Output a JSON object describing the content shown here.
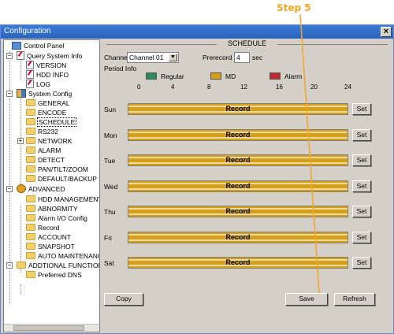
{
  "annotation": {
    "step_label": "Step 5"
  },
  "window": {
    "title": "Configuration",
    "close_glyph": "×"
  },
  "tree": {
    "root": "Control Panel",
    "query": {
      "label": "Query System Info",
      "children": [
        "VERSION",
        "HDD INFO",
        "LOG"
      ]
    },
    "system": {
      "label": "System Config",
      "children": [
        "GENERAL",
        "ENCODE",
        "SCHEDULE",
        "RS232",
        "NETWORK",
        "ALARM",
        "DETECT",
        "PAN/TILT/ZOOM",
        "DEFAULT/BACKUP"
      ]
    },
    "advanced": {
      "label": "ADVANCED",
      "children": [
        "HDD MANAGEMENT",
        "ABNORMITY",
        "Alarm I/O Config",
        "Record",
        "ACCOUNT",
        "SNAPSHOT",
        "AUTO MAINTENANCE"
      ]
    },
    "additional": {
      "label": "ADDTIONAL FUNCTION",
      "children": [
        "Preferred DNS"
      ]
    },
    "expander_minus": "−",
    "expander_plus": "+"
  },
  "schedule": {
    "section_title": "SCHEDULE",
    "channel_label": "Channel",
    "channel_value": "Channel 01",
    "prerecord_label": "Prerecord",
    "prerecord_value": "4",
    "prerecord_unit": "sec",
    "period_info_label": "Period Info",
    "legend": [
      {
        "label": "Regular",
        "color": "#2e8b57"
      },
      {
        "label": "MD",
        "color": "#d4a017"
      },
      {
        "label": "Alarm",
        "color": "#c0282d"
      }
    ],
    "hour_ticks": [
      "0",
      "4",
      "8",
      "12",
      "16",
      "20",
      "24"
    ],
    "days": [
      "Sun",
      "Mon",
      "Tue",
      "Wed",
      "Thu",
      "Fri",
      "Sat"
    ],
    "bar_text": "Record",
    "set_label": "Set",
    "copy_label": "Copy",
    "save_label": "Save",
    "refresh_label": "Refresh",
    "dropdown_glyph": "▼"
  }
}
